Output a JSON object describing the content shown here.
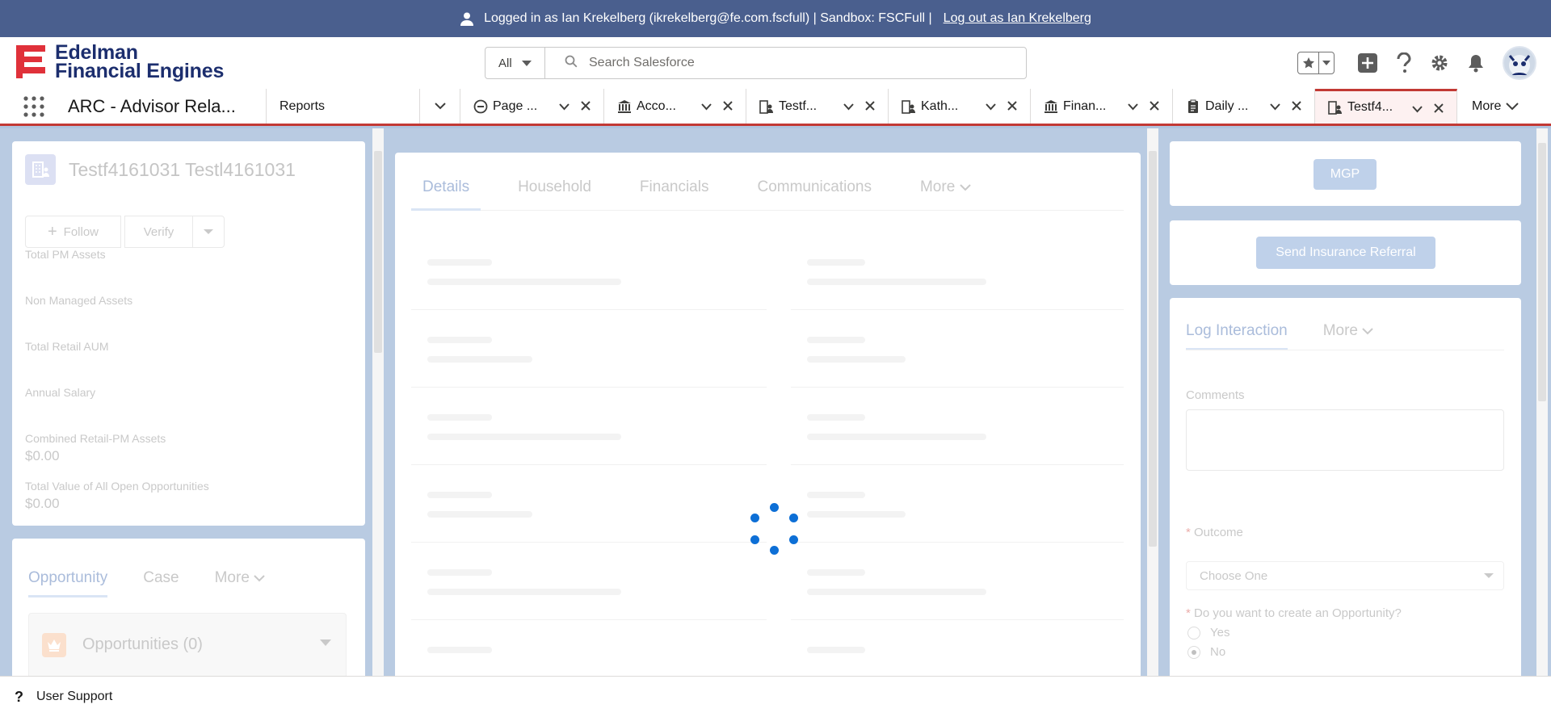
{
  "login_banner": {
    "text": "Logged in as Ian Krekelberg (ikrekelberg@fe.com.fscfull) | Sandbox: FSCFull |",
    "logout_link": "Log out as Ian Krekelberg"
  },
  "header": {
    "logo_line1": "Edelman",
    "logo_line2": "Financial Engines",
    "search_scope": "All",
    "search_placeholder": "Search Salesforce",
    "icons": [
      "star-icon",
      "chevron-down-icon",
      "add-icon",
      "help-icon",
      "gear-icon",
      "bell-icon",
      "avatar"
    ]
  },
  "nav": {
    "app_name": "ARC - Advisor Rela...",
    "reports": "Reports",
    "tabs": [
      {
        "label": "Page ...",
        "icon": "minus-circle-icon"
      },
      {
        "label": "Acco...",
        "icon": "bank-icon"
      },
      {
        "label": "Testf...",
        "icon": "person-account-icon"
      },
      {
        "label": "Kath...",
        "icon": "person-account-icon"
      },
      {
        "label": "Finan...",
        "icon": "bank-icon"
      },
      {
        "label": "Daily ...",
        "icon": "report-icon"
      },
      {
        "label": "Testf4...",
        "icon": "person-account-icon",
        "active": true
      }
    ],
    "more": "More"
  },
  "record": {
    "name": "Testf4161031 Testl4161031",
    "follow": "Follow",
    "verify": "Verify",
    "fields": {
      "total_pm_assets": "Total PM Assets",
      "non_managed_assets": "Non Managed Assets",
      "total_retail_aum": "Total Retail AUM",
      "annual_salary": "Annual Salary",
      "combined_label": "Combined Retail-PM Assets",
      "combined_value": "$0.00",
      "open_opps_label": "Total Value of All Open Opportunities",
      "open_opps_value": "$0.00"
    }
  },
  "related": {
    "tabs": [
      "Opportunity",
      "Case",
      "More"
    ],
    "opportunities_title": "Opportunities (0)"
  },
  "detail_tabs": [
    "Details",
    "Household",
    "Financials",
    "Communications",
    "More"
  ],
  "right_panel": {
    "mgp_button": "MGP",
    "insurance_button": "Send Insurance Referral",
    "tabs": [
      "Log Interaction",
      "More"
    ],
    "comments_label": "Comments",
    "outcome_label": "Outcome",
    "outcome_value": "Choose One",
    "opportunity_question": "Do you want to create an Opportunity?",
    "yes": "Yes",
    "no": "No",
    "selected": "No"
  },
  "utility": {
    "support": "User Support"
  },
  "colors": {
    "banner": "#4a5f8e",
    "accent_red": "#c23934",
    "spinner_blue": "#0d6fd6",
    "brand_blue_disabled": "#b7cbe8"
  }
}
